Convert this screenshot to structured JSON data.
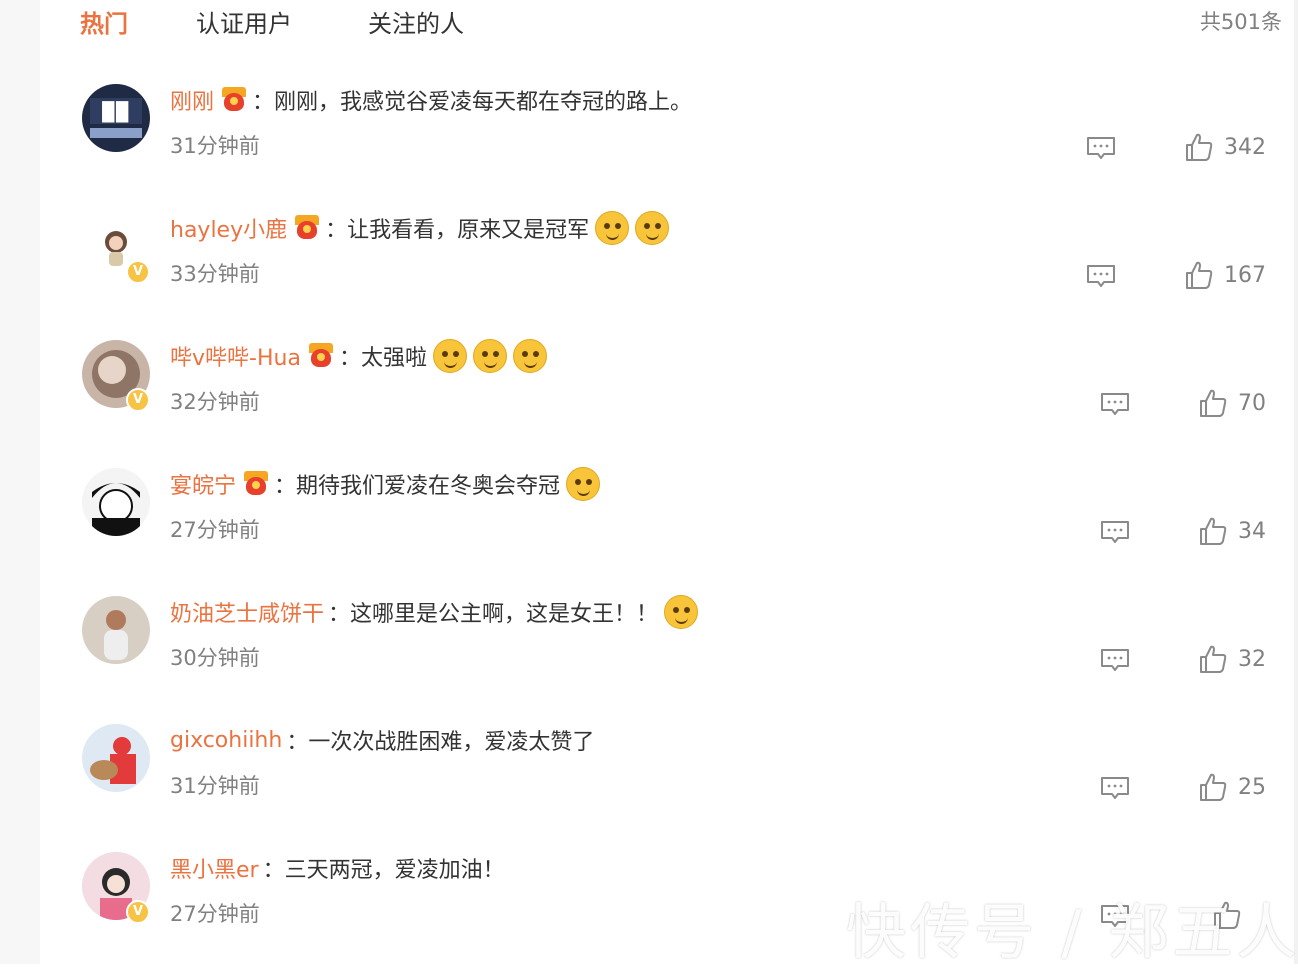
{
  "tabs": [
    {
      "label": "热门",
      "active": true
    },
    {
      "label": "认证用户",
      "active": false
    },
    {
      "label": "关注的人",
      "active": false
    }
  ],
  "total_label": "共501条",
  "colors": {
    "accent": "#eb7340",
    "muted": "#808080",
    "badge": "#f6c344"
  },
  "comments": [
    {
      "username": "刚刚",
      "separator": "：",
      "text": "刚刚，我感觉谷爱凌每天都在夺冠的路上。",
      "time": "31分钟前",
      "likes": "342",
      "verified": false,
      "fan_badge": true,
      "emojis": []
    },
    {
      "username": "hayley小鹿",
      "separator": "：",
      "text": "让我看看，原来又是冠军",
      "time": "33分钟前",
      "likes": "167",
      "verified": true,
      "fan_badge": true,
      "emojis": [
        "smirk-emoji",
        "smirk-emoji"
      ]
    },
    {
      "username": "哔v哔哔-Hua",
      "separator": "：",
      "text": "太强啦",
      "time": "32分钟前",
      "likes": "70",
      "verified": true,
      "fan_badge": true,
      "emojis": [
        "shocked-emoji",
        "shocked-emoji",
        "shocked-emoji"
      ]
    },
    {
      "username": "宴皖宁",
      "separator": "：",
      "text": "期待我们爱凌在冬奥会夺冠",
      "time": "27分钟前",
      "likes": "34",
      "verified": false,
      "fan_badge": true,
      "emojis": [
        "scream-emoji"
      ]
    },
    {
      "username": "奶油芝士咸饼干",
      "separator": "：",
      "text": "这哪里是公主啊，这是女王！！",
      "time": "30分钟前",
      "likes": "32",
      "verified": false,
      "fan_badge": false,
      "emojis": [
        "surprised-emoji"
      ]
    },
    {
      "username": "gixcohiihh",
      "separator": "：",
      "text": "一次次战胜困难，爱凌太赞了",
      "time": "31分钟前",
      "likes": "25",
      "verified": false,
      "fan_badge": false,
      "emojis": []
    },
    {
      "username": "黑小黑er",
      "separator": "：",
      "text": "三天两冠，爱凌加油！",
      "time": "27分钟前",
      "likes": "",
      "verified": true,
      "fan_badge": false,
      "emojis": []
    }
  ],
  "watermark": "快传号 / 郑五人"
}
